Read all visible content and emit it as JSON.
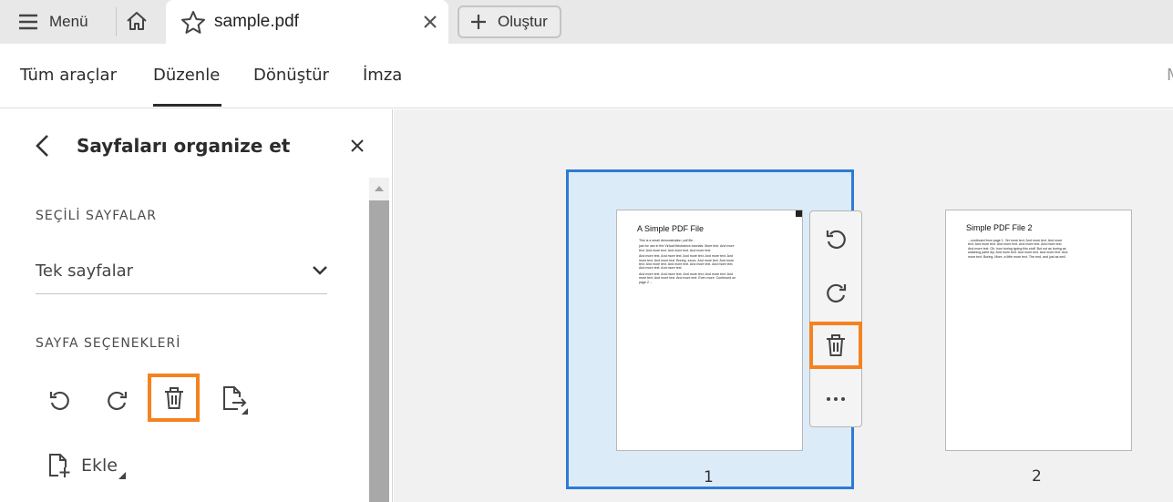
{
  "tabbar": {
    "menu_label": "Menü",
    "tab_title": "sample.pdf",
    "create_label": "Oluştur"
  },
  "toolbar": {
    "items": [
      "Tüm araçlar",
      "Düzenle",
      "Dönüştür",
      "İmza"
    ],
    "active": "Düzenle",
    "overflow_partial": "M"
  },
  "panel": {
    "title": "Sayfaları organize et",
    "selected_section": "SEÇİLİ SAYFALAR",
    "selection_value": "Tek sayfalar",
    "options_section": "SAYFA SEÇENEKLERİ",
    "insert_label": "Ekle"
  },
  "pages": [
    {
      "number": "1",
      "title": "A Simple PDF File",
      "paragraphs": [
        "This is a small demonstration .pdf file -",
        "just for use in the Virtual Mechanics tutorials. More text. And more text. And more text. And more text. And more text.",
        "And more text. And more text. And more text. And more text. And more text. And more text. Boring, zzzzz. And more text. And more text. And more text. And more text. And more text. And more text. And more text. And more text.",
        "And more text. And more text. And more text. And more text. And more text. And more text. And more text. Even more. Continued on page 2 ..."
      ]
    },
    {
      "number": "2",
      "title": "Simple PDF File 2",
      "paragraphs": [
        "...continued from page 1. Yet more text. And more text. And more text. And more text. And more text. And more text. And more text. And more text. Oh, how boring typing this stuff. But not as boring as watching paint dry. And more text. And more text. And more text. And more text. Boring. More, a little more text. The end, and just as well."
      ]
    }
  ],
  "colors": {
    "accent": "#2d7bd6",
    "highlight": "#f58220",
    "selection_fill": "#dcebf8"
  }
}
